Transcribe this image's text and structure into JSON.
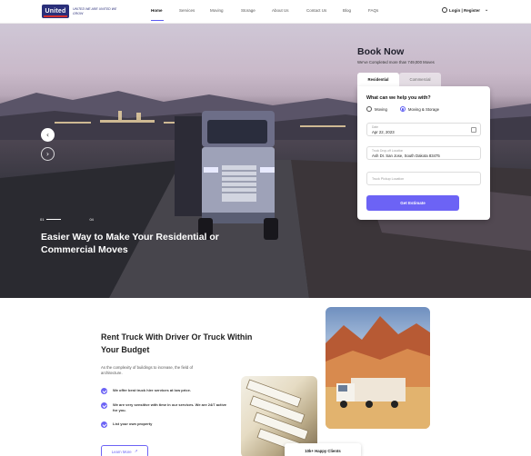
{
  "brand": {
    "logo_text": "United",
    "tagline": "UNITED WE ARE UNITED WE GROW"
  },
  "nav": {
    "items": [
      {
        "label": "Home",
        "active": true
      },
      {
        "label": "Services",
        "active": false
      },
      {
        "label": "Moving",
        "active": false
      },
      {
        "label": "Storage",
        "active": false
      },
      {
        "label": "About Us",
        "active": false
      },
      {
        "label": "Contact Us",
        "active": false
      },
      {
        "label": "Blog",
        "active": false
      },
      {
        "label": "FAQs",
        "active": false
      }
    ],
    "login_label": "Login | Register"
  },
  "hero": {
    "slide_current": "01",
    "slide_total": "04",
    "title": "Easier Way to Make Your Residential or Commercial Moves"
  },
  "booking": {
    "title": "Book Now",
    "subtitle": "We've Completed more than 749,000 Moves",
    "tabs": [
      "Residential",
      "Commercial"
    ],
    "question": "What can we help you with?",
    "options": [
      "Moving",
      "Moving & Storage"
    ],
    "selected_option": "Moving & Storage",
    "date_label": "Date",
    "date_value": "Apr 22, 2023",
    "dropoff_label": "Truck Drop-off Location",
    "dropoff_value": "Ash Dr. San Jose, South Dakota 83475",
    "pickup_placeholder": "Truck Pickup Location",
    "submit_label": "Get Estimate"
  },
  "rent": {
    "title": "Rent Truck With Driver Or Truck Within Your Budget",
    "description": "As the complexity of buildings to increase, the field of architecture.",
    "features": [
      "We offer best truck hire services at low price.",
      "We are very sensitive with time in our services. We are 24/7 active for you.",
      "List your own property"
    ],
    "learn_more_label": "Learn More",
    "clients_label": "10k+ Happy Clients"
  },
  "colors": {
    "accent": "#6c63f5",
    "brand_navy": "#2a2f7a",
    "brand_red": "#d32f2f"
  }
}
